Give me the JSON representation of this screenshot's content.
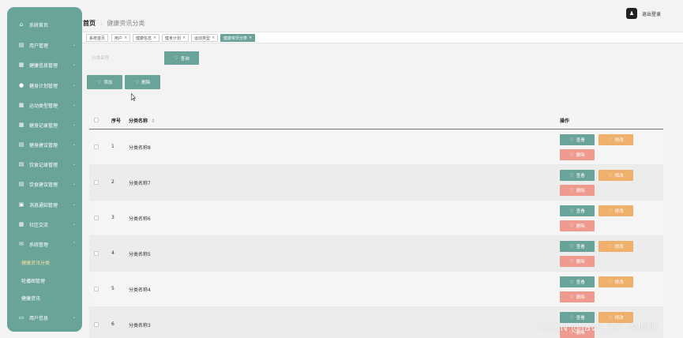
{
  "sidebar": {
    "items": [
      {
        "label": "系统首页",
        "icon": "home-icon",
        "chevron": false
      },
      {
        "label": "用户管理",
        "icon": "list-icon",
        "chevron": true
      },
      {
        "label": "健康信息管理",
        "icon": "grid-icon",
        "chevron": true
      },
      {
        "label": "健身计划管理",
        "icon": "user-icon",
        "chevron": true
      },
      {
        "label": "运动类型管理",
        "icon": "grid-icon",
        "chevron": true
      },
      {
        "label": "健身记录管理",
        "icon": "grid-icon",
        "chevron": true
      },
      {
        "label": "健身建议管理",
        "icon": "list-icon",
        "chevron": true
      },
      {
        "label": "饮食记录管理",
        "icon": "list-icon",
        "chevron": true
      },
      {
        "label": "饮食建议管理",
        "icon": "list-icon",
        "chevron": true
      },
      {
        "label": "消息通知管理",
        "icon": "doc-icon",
        "chevron": true
      },
      {
        "label": "社区交流",
        "icon": "grid-icon",
        "chevron": true
      },
      {
        "label": "系统管理",
        "icon": "envelope-icon",
        "chevron": true,
        "active": true
      }
    ],
    "subitems": [
      {
        "label": "健康资讯分类",
        "active": true
      },
      {
        "label": "轮播图管理",
        "active": false
      },
      {
        "label": "健康资讯",
        "active": false
      }
    ],
    "last_item": {
      "label": "用户信息",
      "icon": "id-card-icon",
      "chevron": true
    }
  },
  "header": {
    "breadcrumb_home": "首页",
    "breadcrumb_sep": ":",
    "breadcrumb_current": "健康资讯分类",
    "logout_avatar": "♟",
    "logout_label": "退出登录"
  },
  "tabs": [
    {
      "label": "系统首页",
      "closable": false,
      "active": false
    },
    {
      "label": "用户",
      "closable": true,
      "active": false
    },
    {
      "label": "健康信息",
      "closable": true,
      "active": false
    },
    {
      "label": "健身计划",
      "closable": true,
      "active": false
    },
    {
      "label": "运动类型",
      "closable": true,
      "active": false
    },
    {
      "label": "健康资讯分类",
      "closable": true,
      "active": true
    }
  ],
  "search": {
    "placeholder": "分类名称",
    "query_label": "查询"
  },
  "actions": {
    "add_label": "添加",
    "delete_label": "删除"
  },
  "table": {
    "headers": {
      "index": "序号",
      "name": "分类名称",
      "sort_icon": "⇕",
      "ops": "操作"
    },
    "rows": [
      {
        "index": "1",
        "name": "分类名称8"
      },
      {
        "index": "2",
        "name": "分类名称7"
      },
      {
        "index": "3",
        "name": "分类名称6"
      },
      {
        "index": "4",
        "name": "分类名称5"
      },
      {
        "index": "5",
        "name": "分类名称4"
      },
      {
        "index": "6",
        "name": "分类名称3"
      }
    ],
    "row_actions": {
      "view": "查看",
      "edit": "修改",
      "delete": "删除"
    }
  },
  "watermark": "CSDN @Java_IoT 攻城狮",
  "colors": {
    "primary": "#6aa39a",
    "warning": "#eeb06a",
    "danger": "#ef9a8f",
    "active_submenu": "#f2e3a0"
  }
}
